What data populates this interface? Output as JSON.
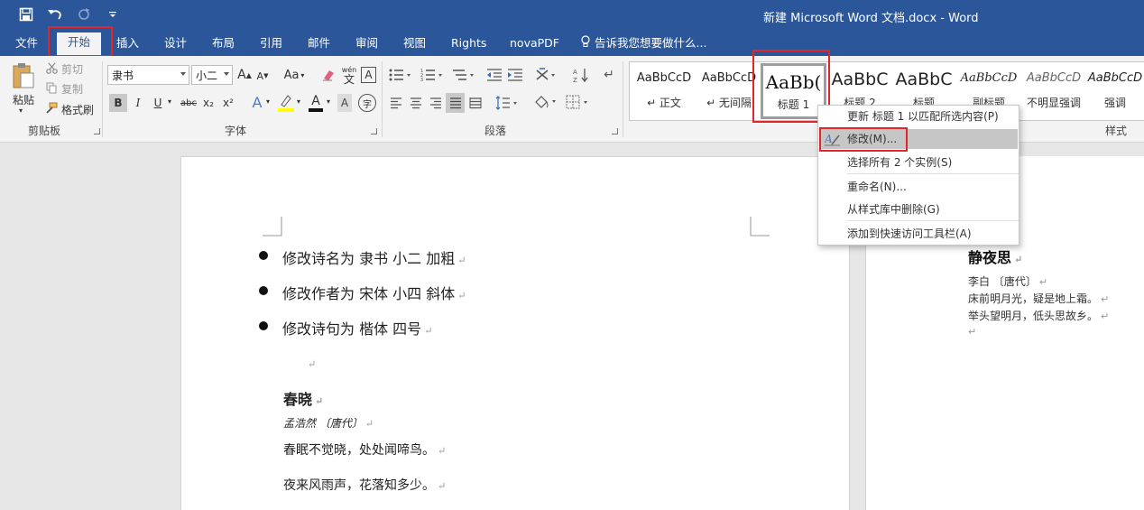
{
  "window": {
    "title": "新建 Microsoft Word 文档.docx - Word"
  },
  "quick_access": [
    "save-icon",
    "undo-icon",
    "redo-icon",
    "customize-icon"
  ],
  "tabs": [
    {
      "label": "文件"
    },
    {
      "label": "开始",
      "active": true
    },
    {
      "label": "插入"
    },
    {
      "label": "设计"
    },
    {
      "label": "布局"
    },
    {
      "label": "引用"
    },
    {
      "label": "邮件"
    },
    {
      "label": "审阅"
    },
    {
      "label": "视图"
    },
    {
      "label": "Rights"
    },
    {
      "label": "novaPDF"
    },
    {
      "label": "告诉我您想要做什么..."
    }
  ],
  "clipboard": {
    "paste": "粘贴",
    "cut": "剪切",
    "copy": "复制",
    "format_painter": "格式刷",
    "group": "剪贴板"
  },
  "font": {
    "name": "隶书",
    "size": "小二",
    "group": "字体",
    "aa": "Aa",
    "grow": "A",
    "shrink": "A",
    "bold": "B",
    "italic": "I",
    "underline": "U",
    "strike": "abc",
    "sub": "x₂",
    "sup": "x²",
    "effects": "A",
    "color": "A",
    "phonetic": "wén",
    "phonetic_char": "文",
    "border_char": "A",
    "enclose_char": "字"
  },
  "paragraph": {
    "group": "段落"
  },
  "styles": {
    "group": "样式",
    "items": [
      {
        "preview": "AaBbCcD",
        "name": "↵ 正文"
      },
      {
        "preview": "AaBbCcD",
        "name": "↵ 无间隔"
      },
      {
        "preview": "AaBb(",
        "name": "标题 1",
        "selected": true
      },
      {
        "preview": "AaBbC",
        "name": "标题 2"
      },
      {
        "preview": "AaBbC",
        "name": "标题"
      },
      {
        "preview": "AaBbCcD",
        "name": "副标题"
      },
      {
        "preview": "AaBbCcD",
        "name": "不明显强调"
      },
      {
        "preview": "AaBbCcD",
        "name": "强调"
      }
    ]
  },
  "context_menu": {
    "items": [
      {
        "label": "更新 标题 1 以匹配所选内容(P)"
      },
      {
        "label": "修改(M)...",
        "highlighted": true
      },
      {
        "label": "选择所有 2 个实例(S)"
      },
      {
        "label": "重命名(N)..."
      },
      {
        "label": "从样式库中删除(G)"
      },
      {
        "label": "添加到快速访问工具栏(A)"
      }
    ]
  },
  "document": {
    "bullets": [
      "修改诗名为 隶书 小二 加粗",
      "修改作者为 宋体 小四 斜体",
      "修改诗句为 楷体 四号"
    ],
    "para_mark": "↵",
    "poem_title": "春晓",
    "poem_author": "孟浩然 〔唐代〕",
    "poem_line1": "春眠不觉晓，处处闻啼鸟。",
    "poem_line2": "夜来风雨声，花落知多少。"
  },
  "side_document": {
    "title": "静夜思",
    "author": "李白 〔唐代〕",
    "line1": "床前明月光，疑是地上霜。",
    "line2": "举头望明月，低头思故乡。"
  },
  "colors": {
    "title_bar": "#2b579a",
    "highlight_box": "#e0262c",
    "ribbon_bg": "#f3f3f3"
  }
}
